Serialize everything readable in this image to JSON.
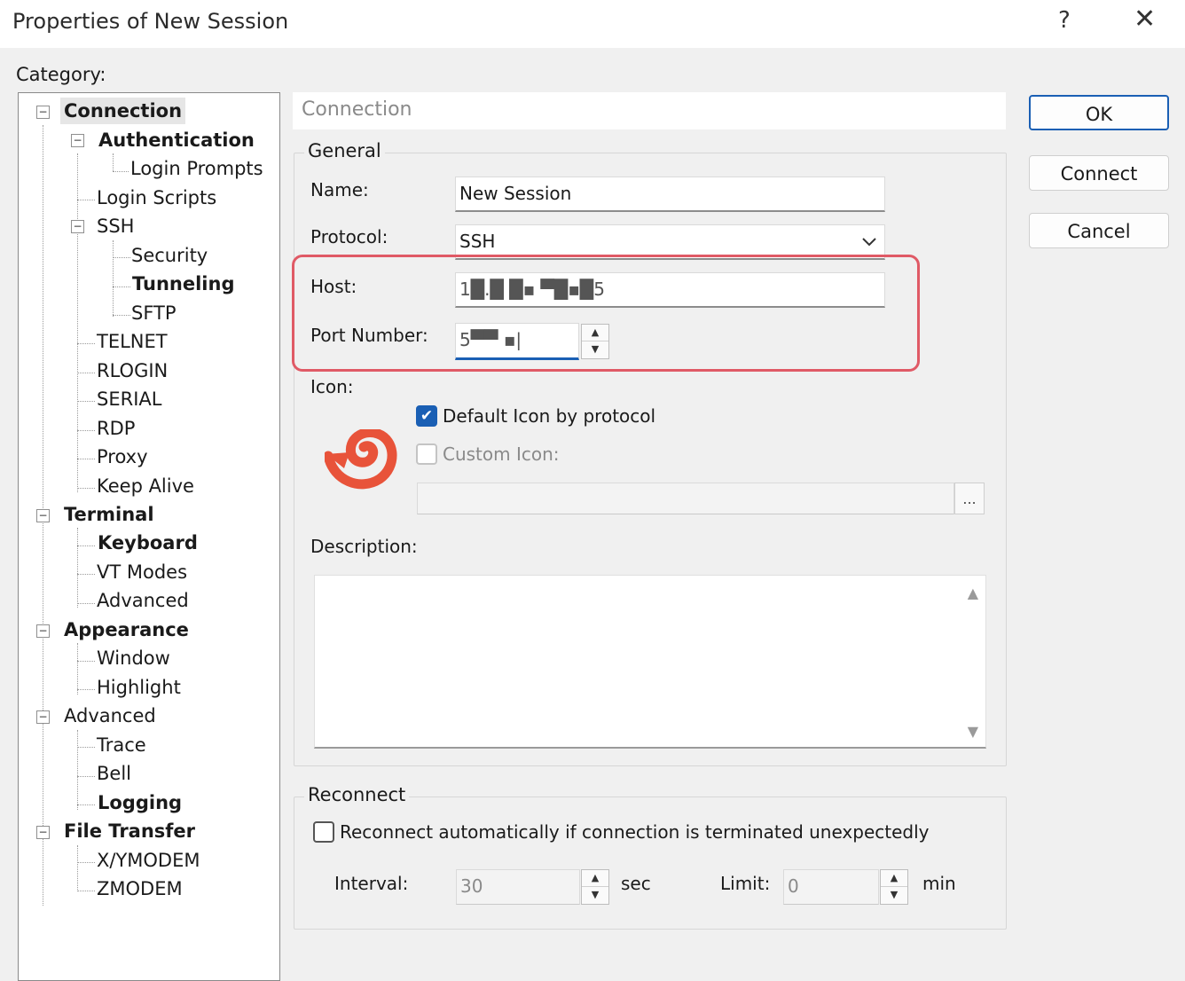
{
  "window": {
    "title": "Properties of New Session",
    "help_label": "?",
    "close_label": "✕"
  },
  "category_label": "Category:",
  "tree": {
    "connection": "Connection",
    "authentication": "Authentication",
    "login_prompts": "Login Prompts",
    "login_scripts": "Login Scripts",
    "ssh": "SSH",
    "security": "Security",
    "tunneling": "Tunneling",
    "sftp": "SFTP",
    "telnet": "TELNET",
    "rlogin": "RLOGIN",
    "serial": "SERIAL",
    "rdp": "RDP",
    "proxy": "Proxy",
    "keep_alive": "Keep Alive",
    "terminal": "Terminal",
    "keyboard": "Keyboard",
    "vt_modes": "VT Modes",
    "advanced_terminal": "Advanced",
    "appearance": "Appearance",
    "window": "Window",
    "highlight": "Highlight",
    "advanced": "Advanced",
    "trace": "Trace",
    "bell": "Bell",
    "logging": "Logging",
    "file_transfer": "File Transfer",
    "xymodem": "X/YMODEM",
    "zmodem": "ZMODEM",
    "expander_glyph": "−"
  },
  "panel": {
    "header": "Connection",
    "general_legend": "General",
    "name_label": "Name:",
    "name_value": "New Session",
    "protocol_label": "Protocol:",
    "protocol_value": "SSH",
    "host_label": "Host:",
    "host_value": "1█.█ █▪ ▀█▪█5",
    "port_label": "Port Number:",
    "port_value": "5▀▀ ▪|",
    "icon_label": "Icon:",
    "default_icon_label": "Default Icon by protocol",
    "custom_icon_label": "Custom Icon:",
    "browse_label": "...",
    "description_label": "Description:",
    "reconnect_legend": "Reconnect",
    "reconnect_label": "Reconnect automatically if connection is terminated unexpectedly",
    "interval_label": "Interval:",
    "interval_value": "30",
    "interval_unit": "sec",
    "limit_label": "Limit:",
    "limit_value": "0",
    "limit_unit": "min"
  },
  "buttons": {
    "ok": "OK",
    "connect": "Connect",
    "cancel": "Cancel"
  },
  "colors": {
    "accent": "#1a5fb4",
    "highlight_box": "#e05a66",
    "protocol_icon": "#e8533a"
  }
}
